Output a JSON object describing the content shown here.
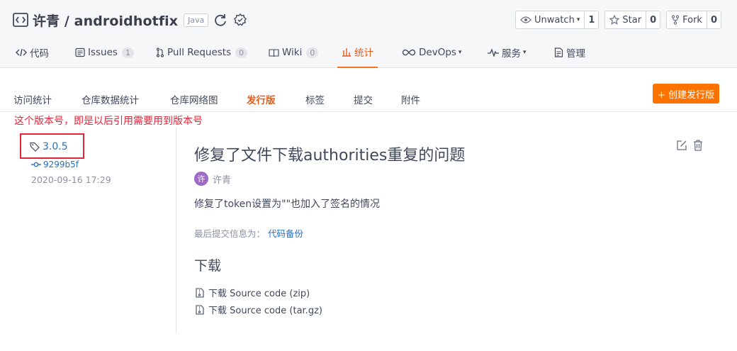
{
  "repo": {
    "name": "许青 / androidhotfix",
    "language": "Java"
  },
  "actions": {
    "watch": {
      "label": "Unwatch",
      "count": "1"
    },
    "star": {
      "label": "Star",
      "count": "0"
    },
    "fork": {
      "label": "Fork",
      "count": "0"
    }
  },
  "nav": {
    "code": {
      "label": "代码"
    },
    "issues": {
      "label": "Issues",
      "count": "1"
    },
    "pull_requests": {
      "label": "Pull Requests",
      "count": "0"
    },
    "wiki": {
      "label": "Wiki",
      "count": "0"
    },
    "stats": {
      "label": "统计"
    },
    "devops": {
      "label": "DevOps"
    },
    "services": {
      "label": "服务"
    },
    "manage": {
      "label": "管理"
    }
  },
  "subnav": {
    "items": [
      "访问统计",
      "仓库数据统计",
      "仓库网络图",
      "发行版",
      "标签",
      "提交",
      "附件"
    ],
    "active_index": 3,
    "create_button": "+ 创建发行版"
  },
  "annotation": "这个版本号，即是以后引用需要用到版本号",
  "release": {
    "tag": "3.0.5",
    "commit": "9299b5f",
    "date": "2020-09-16 17:29",
    "title": "修复了文件下载authorities重复的问题",
    "author": "许青",
    "avatar_letter": "许",
    "description": "修复了token设置为\"\"也加入了签名的情况",
    "last_commit_label": "最后提交信息为：",
    "last_commit_link": "代码备份"
  },
  "downloads": {
    "title": "下载",
    "items": [
      "下载 Source code (zip)",
      "下载 Source code (tar.gz)"
    ]
  },
  "colors": {
    "accent": "#f57724",
    "link": "#2a6fb7",
    "annotation": "#e0263b",
    "create_button": "#fe7300",
    "avatar": "#9d6bc5"
  }
}
